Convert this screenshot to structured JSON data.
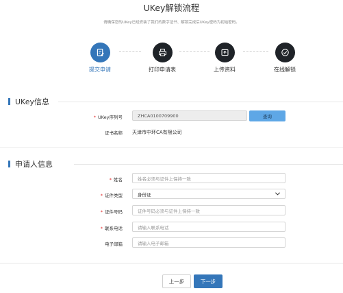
{
  "page": {
    "title": "UKey解锁流程",
    "subtitle": "请确保您的UKey已经安装了我们的数字证书、解锁完成后UKey密码为初始密码。"
  },
  "steps": [
    {
      "label": "提交申请",
      "icon": "edit-doc-icon",
      "active": true
    },
    {
      "label": "打印申请表",
      "icon": "printer-icon",
      "active": false
    },
    {
      "label": "上传资料",
      "icon": "upload-icon",
      "active": false
    },
    {
      "label": "在线解锁",
      "icon": "check-circle-icon",
      "active": false
    }
  ],
  "ukey_section": {
    "title": "UKey信息",
    "serial_label": "UKey序列号",
    "serial_value": "ZHCA0100709900",
    "query_button": "查询",
    "cert_name_label": "证书名称",
    "cert_name_value": "天津市中环CA有限公司"
  },
  "applicant_section": {
    "title": "申请人信息",
    "name_label": "姓名",
    "name_placeholder": "姓名必须与证件上保持一致",
    "id_type_label": "证件类型",
    "id_type_value": "身份证",
    "id_number_label": "证件号码",
    "id_number_placeholder": "证件号码必须与证件上保持一致",
    "phone_label": "联系电话",
    "phone_placeholder": "请输入联系电话",
    "email_label": "电子邮箱",
    "email_placeholder": "请输入电子邮箱"
  },
  "footer": {
    "prev_button": "上一步",
    "next_button": "下一步"
  },
  "colors": {
    "accent": "#3476b9",
    "query_button": "#5ea7e6",
    "step_inactive": "#1f2328",
    "required": "#e02020"
  }
}
